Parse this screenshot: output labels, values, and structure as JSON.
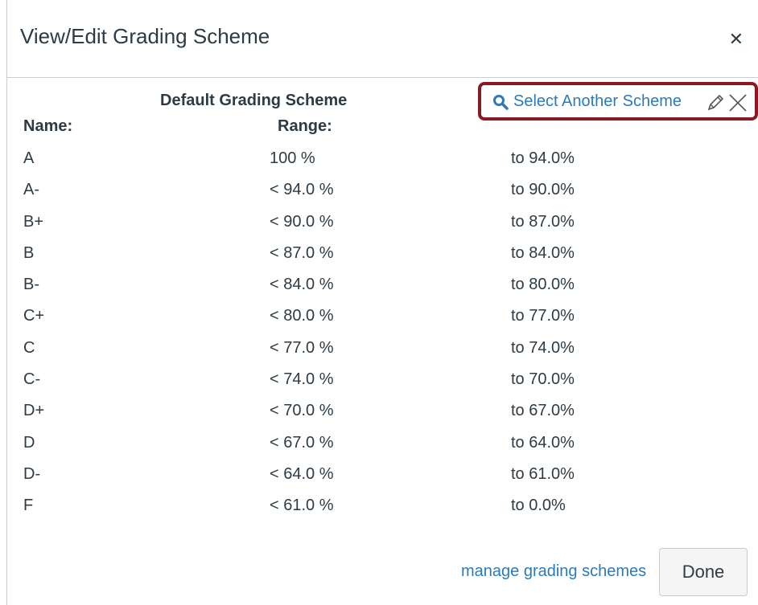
{
  "dialog": {
    "title": "View/Edit Grading Scheme",
    "close_icon": "close-icon"
  },
  "scheme": {
    "name": "Default Grading Scheme",
    "select_another_label": "Select Another Scheme",
    "icons": [
      "search-icon",
      "pencil-icon",
      "remove-icon"
    ]
  },
  "columns": {
    "name": "Name:",
    "range": "Range:"
  },
  "rows": [
    {
      "name": "A",
      "min": "100 %",
      "to": "to  94.0%"
    },
    {
      "name": "A-",
      "min": "< 94.0 %",
      "to": "to  90.0%"
    },
    {
      "name": "B+",
      "min": "< 90.0 %",
      "to": "to  87.0%"
    },
    {
      "name": "B",
      "min": "< 87.0 %",
      "to": "to  84.0%"
    },
    {
      "name": "B-",
      "min": "< 84.0 %",
      "to": "to  80.0%"
    },
    {
      "name": "C+",
      "min": "< 80.0 %",
      "to": "to  77.0%"
    },
    {
      "name": "C",
      "min": "< 77.0 %",
      "to": "to  74.0%"
    },
    {
      "name": "C-",
      "min": "< 74.0 %",
      "to": "to  70.0%"
    },
    {
      "name": "D+",
      "min": "< 70.0 %",
      "to": "to  67.0%"
    },
    {
      "name": "D",
      "min": "< 67.0 %",
      "to": "to  64.0%"
    },
    {
      "name": "D-",
      "min": "< 64.0 %",
      "to": "to  61.0%"
    },
    {
      "name": "F",
      "min": "< 61.0 %",
      "to": "to  0.0%"
    }
  ],
  "footer": {
    "manage_link": "manage grading schemes",
    "done_label": "Done"
  },
  "colors": {
    "link": "#2b7abc",
    "highlight_border": "#8b1a20",
    "text": "#2d3b45"
  }
}
